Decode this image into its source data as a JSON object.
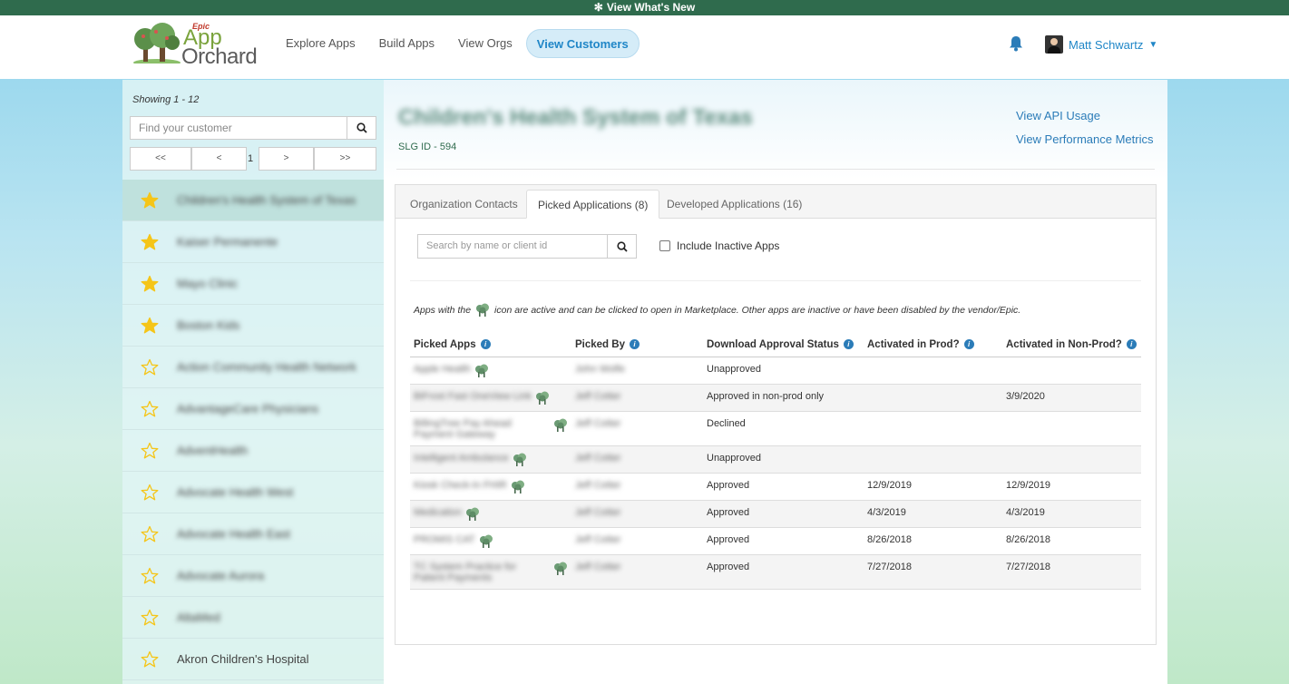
{
  "banner": {
    "text": "View What's New"
  },
  "brand": {
    "epic": "Epic",
    "app": "App",
    "orchard": "Orchard"
  },
  "nav": {
    "items": [
      "Explore Apps",
      "Build Apps",
      "View Orgs",
      "View Customers"
    ],
    "active": "View Customers"
  },
  "user": {
    "name": "Matt Schwartz"
  },
  "sidebar": {
    "showing": "Showing 1 - 12",
    "search_placeholder": "Find your customer",
    "pager": {
      "first": "<<",
      "prev": "<",
      "page": "1",
      "next": ">",
      "last": ">>"
    },
    "customers": [
      {
        "name": "Children's Health System of Texas",
        "favorite": true,
        "selected": true,
        "obscured": true
      },
      {
        "name": "Kaiser Permanente",
        "favorite": true,
        "selected": false,
        "obscured": true
      },
      {
        "name": "Mayo Clinic",
        "favorite": true,
        "selected": false,
        "obscured": true
      },
      {
        "name": "Boston Kids",
        "favorite": true,
        "selected": false,
        "obscured": true
      },
      {
        "name": "Action Community Health Network",
        "favorite": false,
        "selected": false,
        "obscured": true
      },
      {
        "name": "AdvantageCare Physicians",
        "favorite": false,
        "selected": false,
        "obscured": true
      },
      {
        "name": "AdventHealth",
        "favorite": false,
        "selected": false,
        "obscured": true
      },
      {
        "name": "Advocate Health West",
        "favorite": false,
        "selected": false,
        "obscured": true
      },
      {
        "name": "Advocate Health East",
        "favorite": false,
        "selected": false,
        "obscured": true
      },
      {
        "name": "Advocate Aurora",
        "favorite": false,
        "selected": false,
        "obscured": true
      },
      {
        "name": "AltaMed",
        "favorite": false,
        "selected": false,
        "obscured": true
      },
      {
        "name": "Akron Children's Hospital",
        "favorite": false,
        "selected": false,
        "obscured": false
      }
    ]
  },
  "customer": {
    "title": "Children's Health System of Texas",
    "slg": "SLG ID - 594",
    "links": [
      "View API Usage",
      "View Performance Metrics"
    ]
  },
  "tabs": [
    "Organization Contacts",
    "Picked Applications (8)",
    "Developed Applications (16)"
  ],
  "active_tab": "Picked Applications (8)",
  "apps_search": {
    "placeholder": "Search by name or client id",
    "include_inactive": "Include Inactive Apps"
  },
  "note": {
    "before": "Apps with the",
    "after": "icon are active and can be clicked to open in Marketplace. Other apps are inactive or have been disabled by the vendor/Epic."
  },
  "table": {
    "columns": [
      "Picked Apps",
      "Picked By",
      "Download Approval Status",
      "Activated in Prod?",
      "Activated in Non-Prod?"
    ],
    "rows": [
      {
        "app": "Apple Health",
        "by": "John Wolfe",
        "status": "Unapproved",
        "prod": "",
        "nonprod": ""
      },
      {
        "app": "BiFrost Fast OneView Link",
        "by": "Jeff Cotter",
        "status": "Approved in non-prod only",
        "prod": "",
        "nonprod": "3/9/2020"
      },
      {
        "app": "BillingTree Pay Ahead Payment Gateway",
        "by": "Jeff Cotter",
        "status": "Declined",
        "prod": "",
        "nonprod": ""
      },
      {
        "app": "Intelligent Ambulance",
        "by": "Jeff Cotter",
        "status": "Unapproved",
        "prod": "",
        "nonprod": ""
      },
      {
        "app": "Kiosk Check-In FHIR",
        "by": "Jeff Cotter",
        "status": "Approved",
        "prod": "12/9/2019",
        "nonprod": "12/9/2019"
      },
      {
        "app": "Medication",
        "by": "Jeff Cotter",
        "status": "Approved",
        "prod": "4/3/2019",
        "nonprod": "4/3/2019"
      },
      {
        "app": "PROMIS CAT",
        "by": "Jeff Cotter",
        "status": "Approved",
        "prod": "8/26/2018",
        "nonprod": "8/26/2018"
      },
      {
        "app": "TC System Practice for Patient Payments",
        "by": "Jeff Cotter",
        "status": "Approved",
        "prod": "7/27/2018",
        "nonprod": "7/27/2018"
      }
    ]
  },
  "colors": {
    "banner": "#2f6b4d",
    "accent": "#1f86c7",
    "star": "#f5c518",
    "selected_row": "#bfe1dd"
  }
}
